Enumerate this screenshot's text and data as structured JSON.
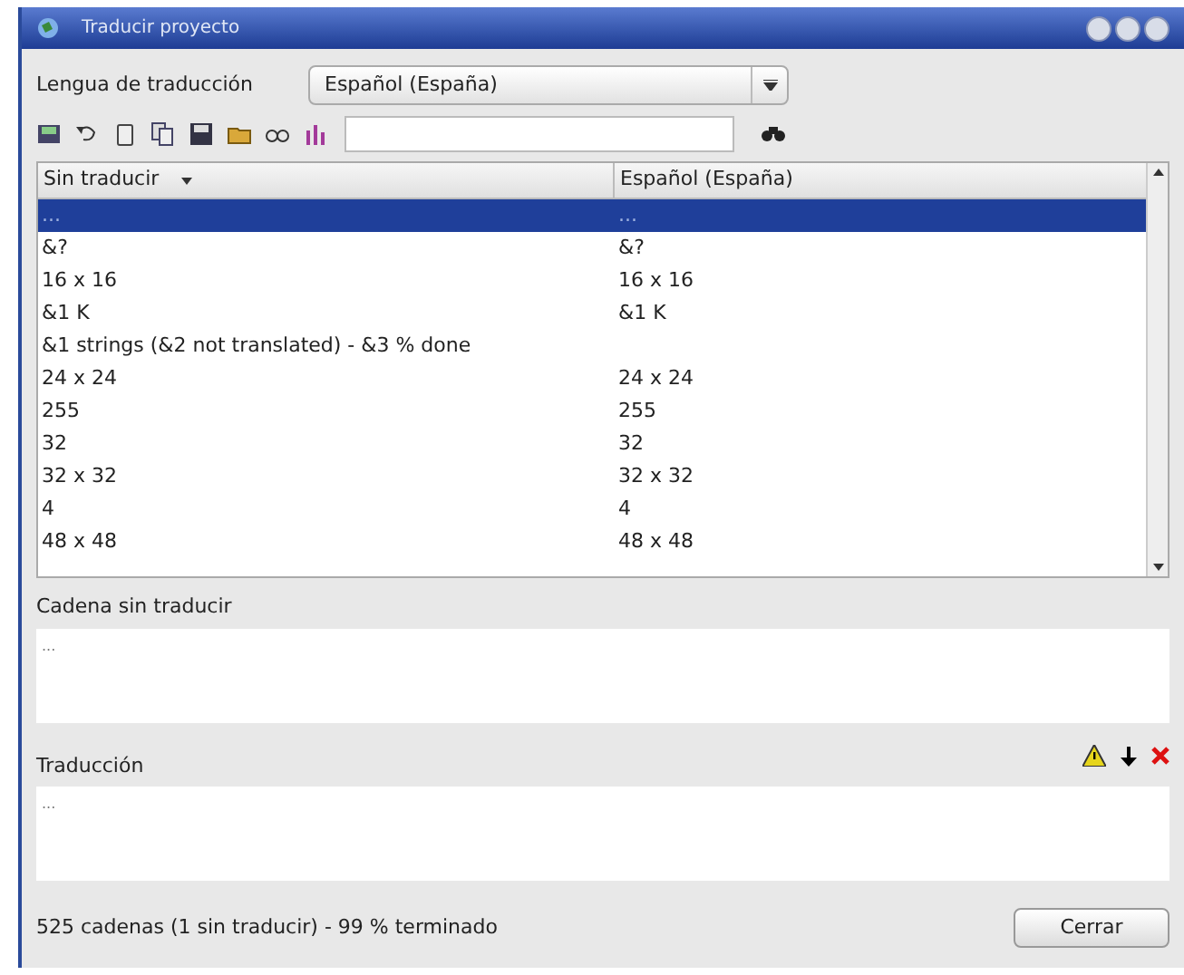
{
  "window": {
    "title": "Traducir proyecto"
  },
  "language": {
    "label": "Lengua de traducción",
    "value": "Español (España)"
  },
  "table": {
    "columns": [
      {
        "label": "Sin traducir",
        "sorted": true
      },
      {
        "label": "Español (España)",
        "sorted": false
      }
    ],
    "rows": [
      {
        "source": "...",
        "translation": "...",
        "selected": true
      },
      {
        "source": "&?",
        "translation": "&?",
        "selected": false
      },
      {
        "source": "16 x 16",
        "translation": "16 x 16",
        "selected": false
      },
      {
        "source": "&1 K",
        "translation": "&1 K",
        "selected": false
      },
      {
        "source": "&1 strings (&2 not translated) - &3 % done",
        "translation": "",
        "selected": false
      },
      {
        "source": "24 x 24",
        "translation": "24 x 24",
        "selected": false
      },
      {
        "source": "255",
        "translation": "255",
        "selected": false
      },
      {
        "source": "32",
        "translation": "32",
        "selected": false
      },
      {
        "source": "32 x 32",
        "translation": "32 x 32",
        "selected": false
      },
      {
        "source": "4",
        "translation": "4",
        "selected": false
      },
      {
        "source": "48 x 48",
        "translation": "48 x 48",
        "selected": false
      }
    ]
  },
  "source_string": {
    "label": "Cadena sin traducir",
    "value": "..."
  },
  "translation": {
    "label": "Traducción",
    "value": "..."
  },
  "status": "525 cadenas (1 sin traducir) - 99 % terminado",
  "buttons": [
    "Cerrar"
  ]
}
